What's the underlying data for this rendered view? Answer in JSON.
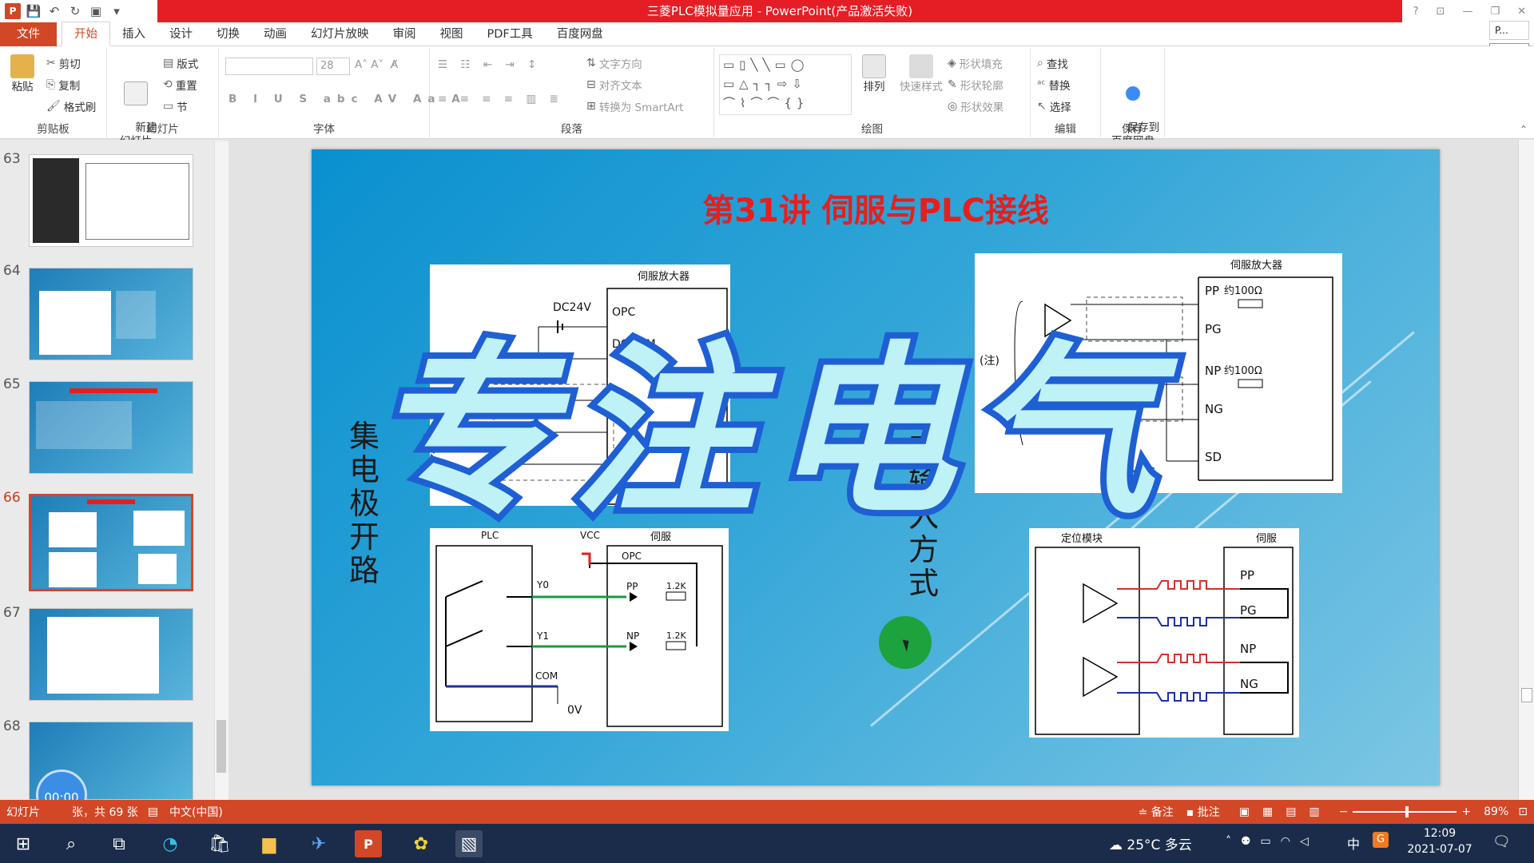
{
  "window": {
    "title": "三菱PLC模拟量应用 - PowerPoint(产品激活失败)",
    "right_label": "P...",
    "right_button": "开始"
  },
  "menu": {
    "tabs": [
      "文件",
      "开始",
      "插入",
      "设计",
      "切换",
      "动画",
      "幻灯片放映",
      "审阅",
      "视图",
      "PDF工具",
      "百度网盘"
    ],
    "active": "开始"
  },
  "ribbon": {
    "clipboard": {
      "label": "剪贴板",
      "paste": "粘贴",
      "cut": "剪切",
      "copy": "复制",
      "format_painter": "格式刷"
    },
    "slides": {
      "label": "幻灯片",
      "new_slide": "新建\n幻灯片",
      "layout": "版式",
      "reset": "重置",
      "section": "节"
    },
    "font": {
      "label": "字体",
      "font_name": "",
      "font_size": "28"
    },
    "paragraph": {
      "label": "段落",
      "text_direction": "文字方向",
      "align_text": "对齐文本",
      "smartart": "转换为 SmartArt"
    },
    "drawing": {
      "label": "绘图",
      "arrange": "排列",
      "quick_styles": "快速样式",
      "shape_fill": "形状填充",
      "shape_outline": "形状轮廓",
      "shape_effects": "形状效果"
    },
    "editing": {
      "label": "编辑",
      "find": "查找",
      "replace": "替换",
      "select": "选择"
    },
    "save": {
      "label": "保存",
      "save_to_baidu": "保存到\n百度网盘"
    }
  },
  "slides_panel": {
    "numbers": [
      "63",
      "64",
      "65",
      "66",
      "67",
      "68"
    ],
    "active": "66"
  },
  "slide": {
    "title": "第31讲  伺服与PLC接线",
    "left_vertical_label": "集电极开路",
    "right_vertical_label": "动输入方式",
    "diagram_tl": {
      "amp": "伺服放大器",
      "dc": "DC24V",
      "opc": "OPC",
      "docom": "DOCOM"
    },
    "diagram_tr": {
      "amp": "伺服放大器",
      "pp": "PP",
      "pg": "PG",
      "np": "NP",
      "ng": "NG",
      "sd": "SD",
      "r1": "约100Ω",
      "r2": "约100Ω",
      "note": "(注)"
    },
    "diagram_bl": {
      "plc": "PLC",
      "vcc": "VCC",
      "servo": "伺服",
      "opc": "OPC",
      "y0": "Y0",
      "y1": "Y1",
      "pp": "PP",
      "np": "NP",
      "com": "COM",
      "ov": "0V",
      "r1": "1.2K",
      "r2": "1.2K"
    },
    "diagram_br": {
      "module": "定位模块",
      "servo": "伺服",
      "pp": "PP",
      "pg": "PG",
      "np": "NP",
      "ng": "NG"
    },
    "watermark": "专注电气"
  },
  "timer": "00:00",
  "status": {
    "slide_info": "幻灯片",
    "slide_total": "张，共 69 张",
    "language": "中文(中国)",
    "notes": "备注",
    "comments": "批注",
    "zoom": "89%"
  },
  "taskbar": {
    "weather": "25°C 多云",
    "ime": "中",
    "time": "12:09",
    "date": "2021-07-07"
  },
  "colors": {
    "accent": "#d24726",
    "title_red": "#e51e25",
    "slide_blue": "#1a96d2",
    "watermark": "#bff2f6",
    "watermark_outline": "#1f5fd4"
  }
}
